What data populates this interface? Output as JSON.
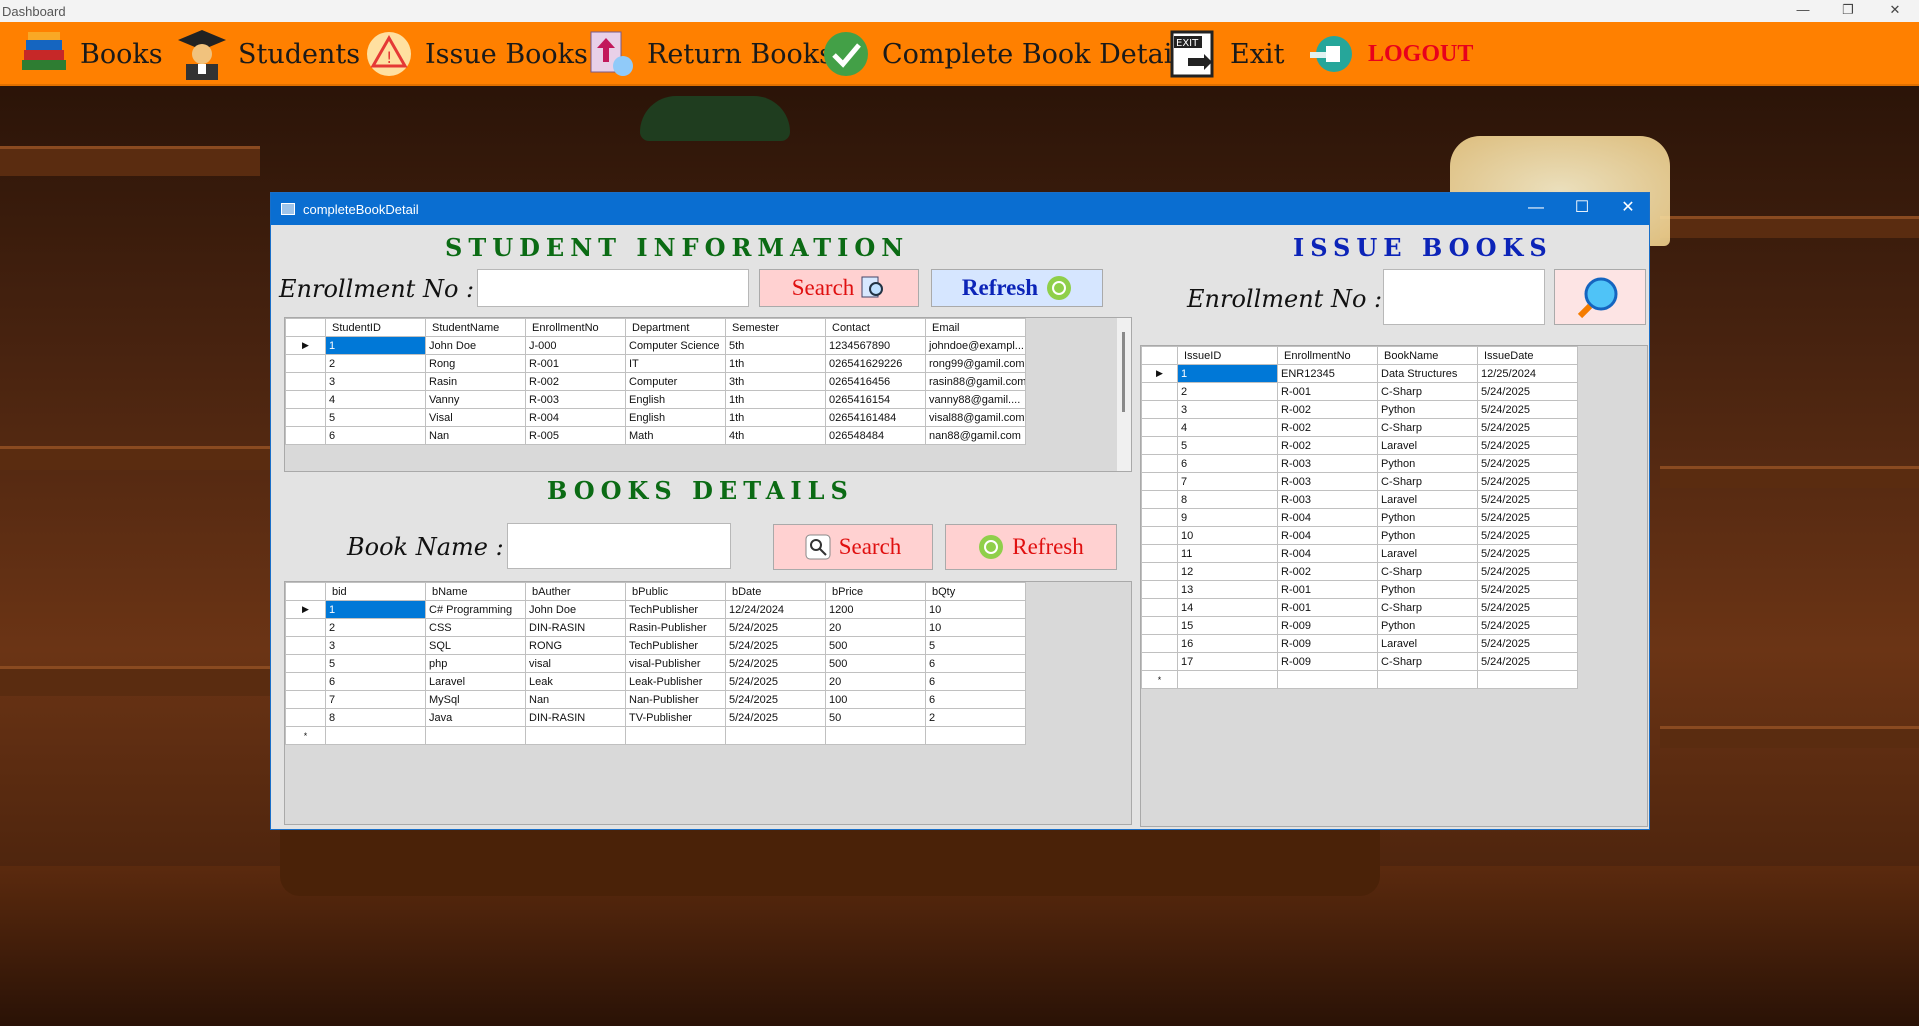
{
  "app": {
    "title": "Dashboard"
  },
  "menu": {
    "items": [
      {
        "label": "Books",
        "icon": "books-icon"
      },
      {
        "label": "Students",
        "icon": "graduate-icon"
      },
      {
        "label": "Issue Books",
        "icon": "warning-icon"
      },
      {
        "label": "Return Books",
        "icon": "return-icon"
      },
      {
        "label": "Complete Book Details",
        "icon": "check-badge-icon"
      },
      {
        "label": "Exit",
        "icon": "exit-door-icon"
      },
      {
        "label": "LOGOUT",
        "icon": "logout-icon"
      }
    ]
  },
  "child": {
    "title": "completeBookDetail",
    "student_section": {
      "heading": "STUDENT INFORMATION",
      "enroll_label": "Enrollment No :",
      "enroll_value": "",
      "search_label": "Search",
      "refresh_label": "Refresh",
      "columns": [
        "StudentID",
        "StudentName",
        "EnrollmentNo",
        "Department",
        "Semester",
        "Contact",
        "Email"
      ],
      "rows": [
        [
          "1",
          "John Doe",
          "J-000",
          "Computer Science",
          "5th",
          "1234567890",
          "johndoe@exampl..."
        ],
        [
          "2",
          "Rong",
          "R-001",
          "IT",
          "1th",
          "02654162922​6",
          "rong99@gamil.com"
        ],
        [
          "3",
          "Rasin",
          "R-002",
          "Computer",
          "3th",
          "0265416456",
          "rasin88@gamil.com"
        ],
        [
          "4",
          "Vanny",
          "R-003",
          "English",
          "1th",
          "0265416154",
          "vanny88@gamil...."
        ],
        [
          "5",
          "Visal",
          "R-004",
          "English",
          "1th",
          "02654161484",
          "visal88@gamil.com"
        ],
        [
          "6",
          "Nan",
          "R-005",
          "Math",
          "4th",
          "026548484",
          "nan88@gamil.com"
        ]
      ]
    },
    "books_section": {
      "heading": "BOOKS DETAILS",
      "name_label": "Book Name :",
      "name_value": "",
      "search_label": "Search",
      "refresh_label": "Refresh",
      "columns": [
        "bid",
        "bName",
        "bAuther",
        "bPublic",
        "bDate",
        "bPrice",
        "bQty"
      ],
      "rows": [
        [
          "1",
          "C# Programming",
          "John Doe",
          "TechPublisher",
          "12/24/2024",
          "1200",
          "10"
        ],
        [
          "2",
          "CSS",
          "DIN-RASIN",
          "Rasin-Publisher",
          "5/24/2025",
          "20",
          "10"
        ],
        [
          "3",
          "SQL",
          "RONG",
          "TechPublisher",
          "5/24/2025",
          "500",
          "5"
        ],
        [
          "5",
          "php",
          "visal",
          "visal-Publisher",
          "5/24/2025",
          "500",
          "6"
        ],
        [
          "6",
          "Laravel",
          "Leak",
          "Leak-Publisher",
          "5/24/2025",
          "20",
          "6"
        ],
        [
          "7",
          "MySql",
          "Nan",
          "Nan-Publisher",
          "5/24/2025",
          "100",
          "6"
        ],
        [
          "8",
          "Java",
          "DIN-RASIN",
          "TV-Publisher",
          "5/24/2025",
          "50",
          "2"
        ]
      ]
    },
    "issue_section": {
      "heading": "ISSUE BOOKS",
      "enroll_label": "Enrollment No :",
      "enroll_value": "",
      "columns": [
        "IssueID",
        "EnrollmentNo",
        "BookName",
        "IssueDate"
      ],
      "rows": [
        [
          "1",
          "ENR12345",
          "Data Structures",
          "12/25/2024"
        ],
        [
          "2",
          "R-001",
          "C-Sharp",
          "5/24/2025"
        ],
        [
          "3",
          "R-002",
          "Python",
          "5/24/2025"
        ],
        [
          "4",
          "R-002",
          "C-Sharp",
          "5/24/2025"
        ],
        [
          "5",
          "R-002",
          "Laravel",
          "5/24/2025"
        ],
        [
          "6",
          "R-003",
          "Python",
          "5/24/2025"
        ],
        [
          "7",
          "R-003",
          "C-Sharp",
          "5/24/2025"
        ],
        [
          "8",
          "R-003",
          "Laravel",
          "5/24/2025"
        ],
        [
          "9",
          "R-004",
          "Python",
          "5/24/2025"
        ],
        [
          "10",
          "R-004",
          "Python",
          "5/24/2025"
        ],
        [
          "11",
          "R-004",
          "Laravel",
          "5/24/2025"
        ],
        [
          "12",
          "R-002",
          "C-Sharp",
          "5/24/2025"
        ],
        [
          "13",
          "R-001",
          "Python",
          "5/24/2025"
        ],
        [
          "14",
          "R-001",
          "C-Sharp",
          "5/24/2025"
        ],
        [
          "15",
          "R-009",
          "Python",
          "5/24/2025"
        ],
        [
          "16",
          "R-009",
          "Laravel",
          "5/24/2025"
        ],
        [
          "17",
          "R-009",
          "C-Sharp",
          "5/24/2025"
        ]
      ]
    }
  },
  "colors": {
    "menu_bg": "#ff8000",
    "accent_green": "#0b6b14",
    "accent_blue": "#0c24b8",
    "selection": "#0078d7"
  }
}
